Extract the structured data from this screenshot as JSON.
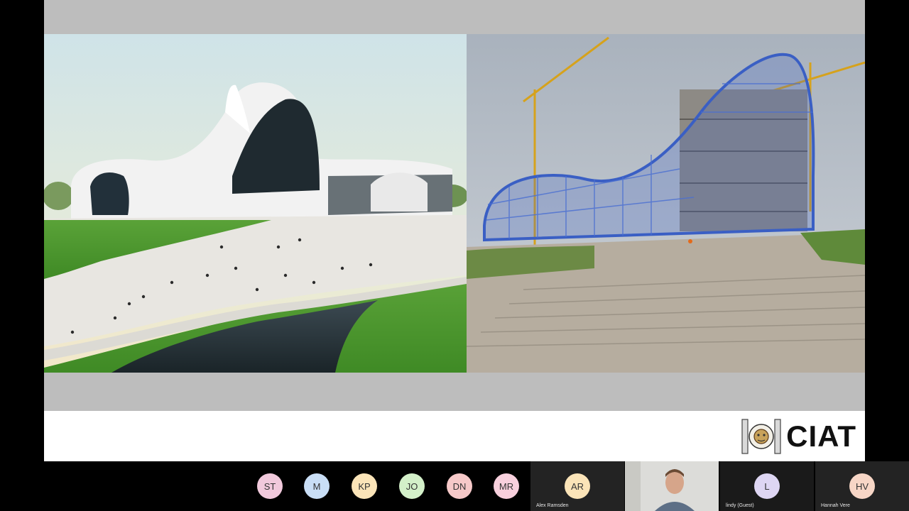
{
  "slide": {
    "left_image_alt": "Rendering of flowing white curved building with plaza, lawns and pool",
    "right_image_alt": "Construction site of curved building with blue steel space frame and tower cranes",
    "logo_text": "CIAT"
  },
  "participants": [
    {
      "initials": "ST",
      "color": "#f1c9dc"
    },
    {
      "initials": "M",
      "color": "#c9def6"
    },
    {
      "initials": "KP",
      "color": "#fbe4b8"
    },
    {
      "initials": "JO",
      "color": "#d3f0c9"
    },
    {
      "initials": "DN",
      "color": "#f6c9c9"
    },
    {
      "initials": "MR",
      "color": "#f8d0dd"
    }
  ],
  "named_tiles": [
    {
      "initials": "AR",
      "name": "Alex Ramsden",
      "color": "#fbe4b8"
    },
    {
      "initials": "",
      "name": "",
      "color": ""
    },
    {
      "initials": "L",
      "name": "lindy (Guest)",
      "color": "#ded6f3"
    },
    {
      "initials": "HV",
      "name": "Hannah Vere",
      "color": "#f7d6c6"
    }
  ],
  "colors": {
    "slide_bg": "#bdbdbd",
    "footer_bg": "#ffffff",
    "frame_blue": "#3a5fc4"
  }
}
